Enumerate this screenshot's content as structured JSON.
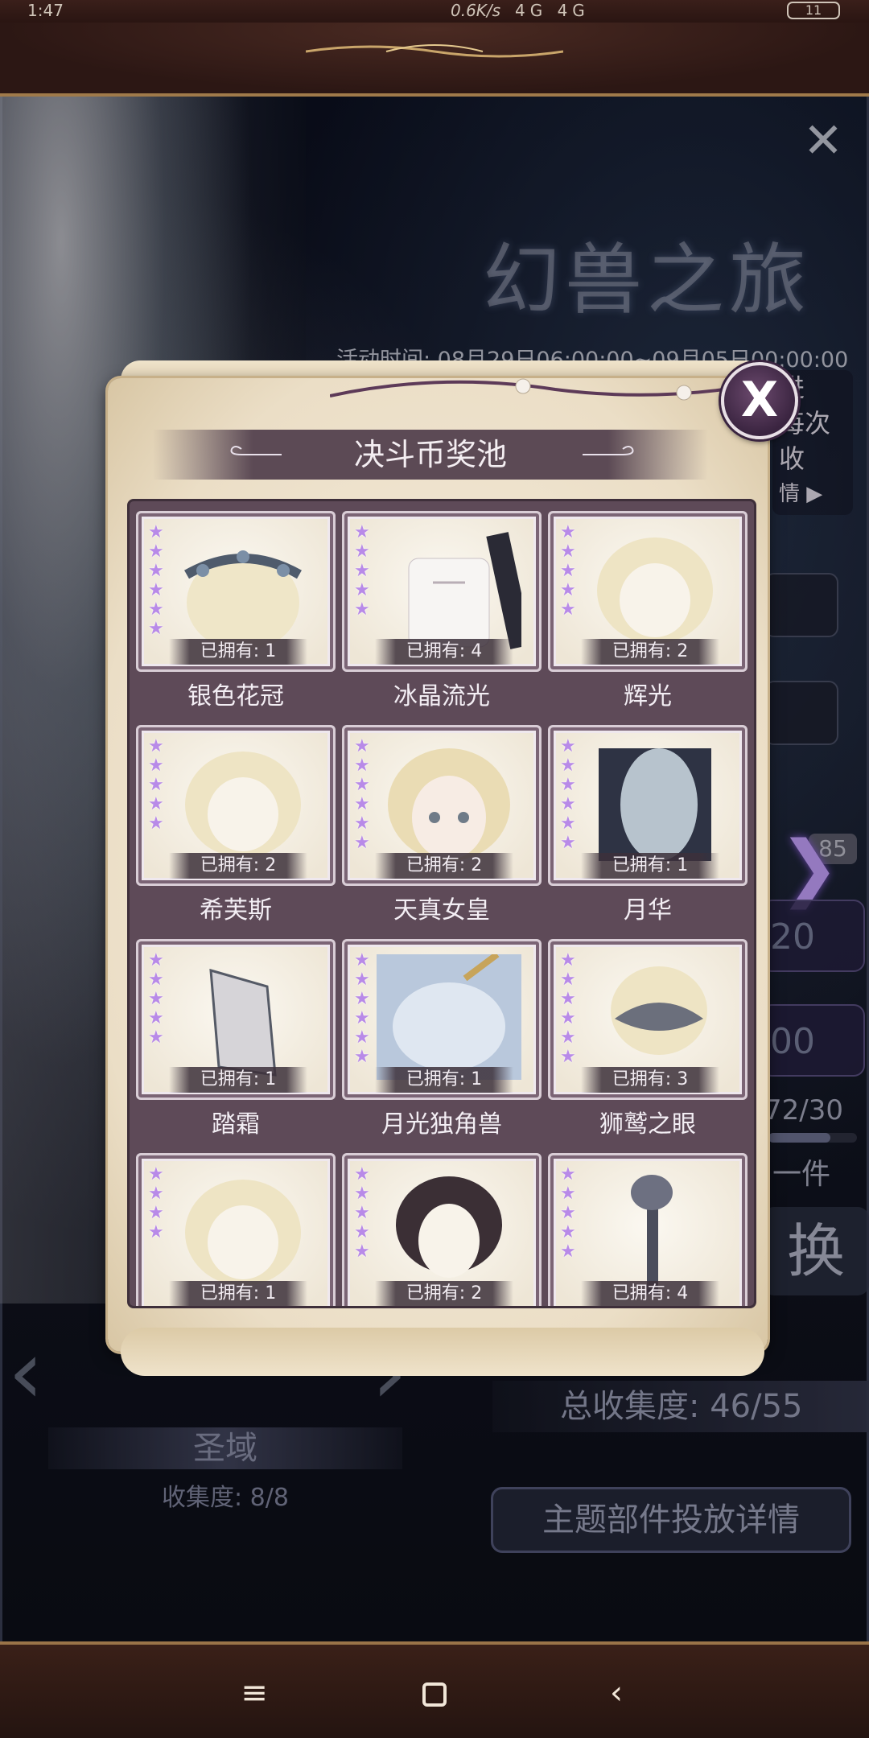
{
  "status_bar": {
    "time": "1:47",
    "speed": "0.6K/s",
    "network": "4G 4G",
    "battery": "11"
  },
  "background": {
    "event_title": "幻兽之旅",
    "event_time": "活动时间: 08月29日06:00:00~09月05日00:00:00",
    "side_note": [
      "进",
      "每次",
      "收"
    ],
    "side_detail": "情 ▶",
    "right_count": "85",
    "right_num_1": "20",
    "right_num_2": "00",
    "right_progress": "72/30",
    "right_progress_fraction": 0.7,
    "right_hint": "一件",
    "right_exchange": "换",
    "total_collect": "总收集度:  46/55",
    "region_name": "圣域",
    "region_collect": "收集度: 8/8",
    "theme_detail": "主题部件投放详情"
  },
  "modal": {
    "title": "决斗币奖池",
    "close_label": "X",
    "items": [
      {
        "name": "银色花冠",
        "owned": "已拥有: 1",
        "stars": 6,
        "art": "crown"
      },
      {
        "name": "冰晶流光",
        "owned": "已拥有: 4",
        "stars": 5,
        "art": "dress"
      },
      {
        "name": "辉光",
        "owned": "已拥有: 2",
        "stars": 5,
        "art": "hair"
      },
      {
        "name": "希芙斯",
        "owned": "已拥有: 2",
        "stars": 5,
        "art": "hair"
      },
      {
        "name": "天真女皇",
        "owned": "已拥有: 2",
        "stars": 6,
        "art": "face"
      },
      {
        "name": "月华",
        "owned": "已拥有: 1",
        "stars": 6,
        "art": "gown"
      },
      {
        "name": "踏霜",
        "owned": "已拥有: 1",
        "stars": 5,
        "art": "shoe"
      },
      {
        "name": "月光独角兽",
        "owned": "已拥有: 1",
        "stars": 6,
        "art": "unicorn"
      },
      {
        "name": "狮鹫之眼",
        "owned": "已拥有: 3",
        "stars": 6,
        "art": "mask"
      },
      {
        "name": "",
        "owned": "已拥有: 1",
        "stars": 4,
        "art": "hair"
      },
      {
        "name": "",
        "owned": "已拥有: 2",
        "stars": 5,
        "art": "darkhair"
      },
      {
        "name": "",
        "owned": "已拥有: 4",
        "stars": 5,
        "art": "staff"
      }
    ]
  },
  "navbar": {
    "menu_icon": "≡",
    "back_icon": "‹"
  }
}
